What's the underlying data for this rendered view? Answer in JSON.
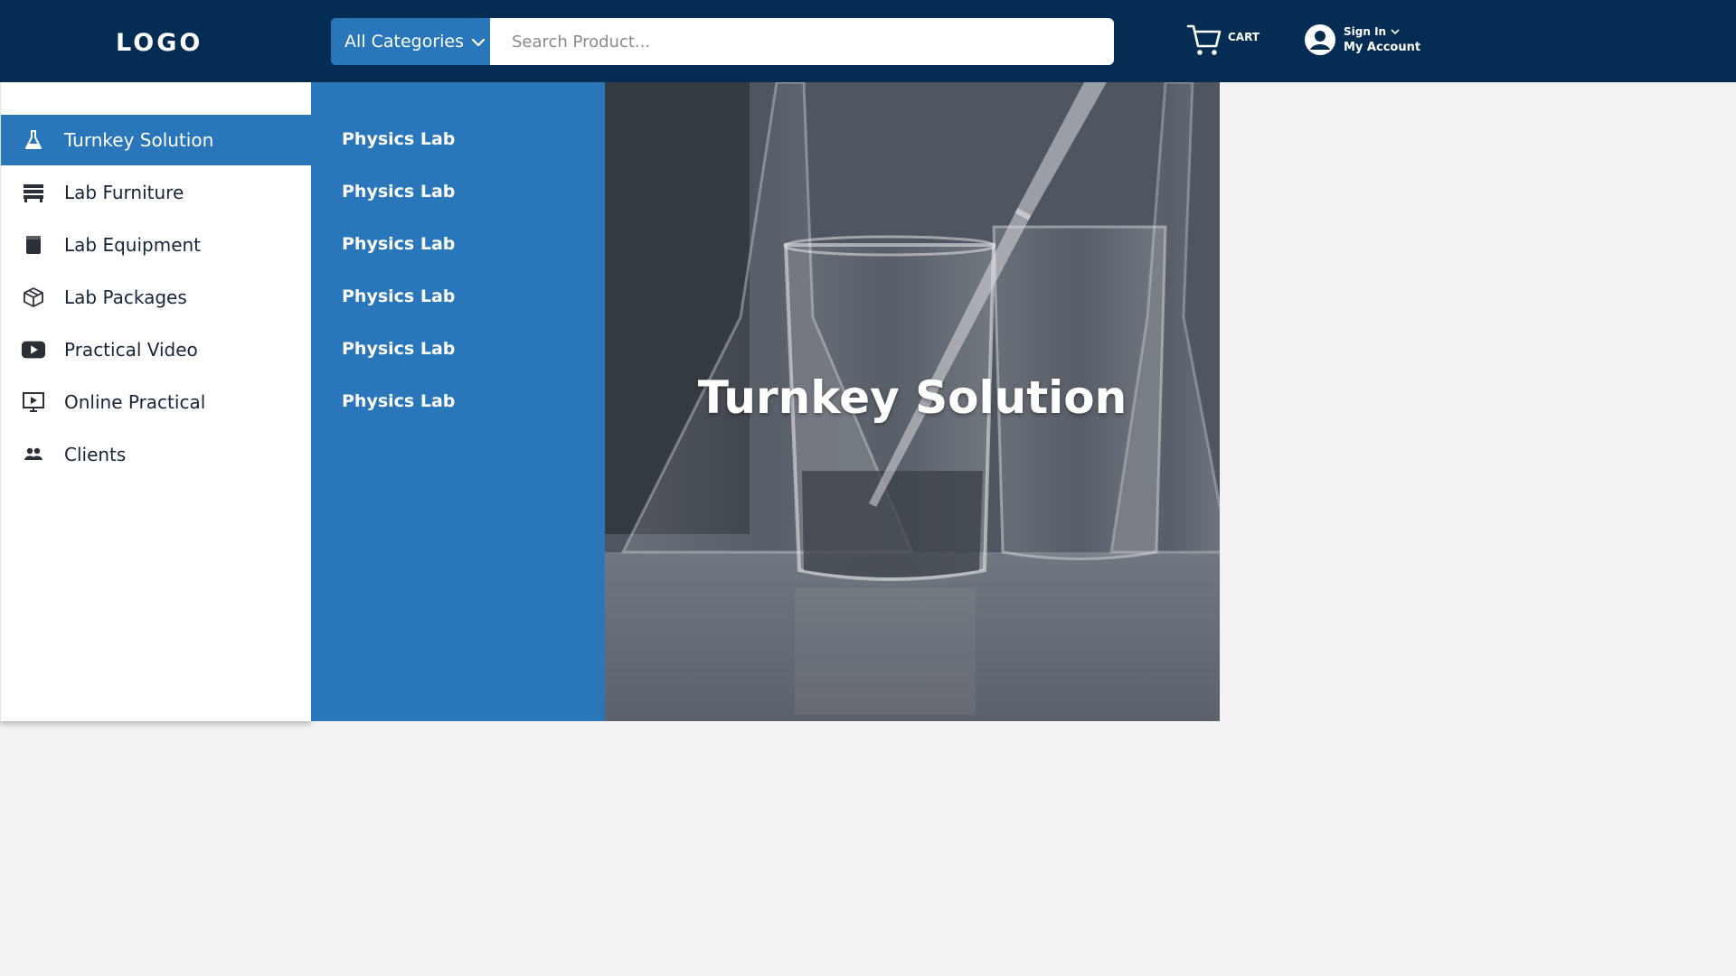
{
  "header": {
    "logo": "LOGO",
    "category_button": "All Categories",
    "search_placeholder": "Search Product...",
    "cart_label": "CART",
    "sign_in": "Sign In",
    "my_account": "My Account"
  },
  "sidebar": {
    "items": [
      {
        "label": "Turnkey Solution",
        "icon": "flask-icon",
        "active": true
      },
      {
        "label": "Lab Furniture",
        "icon": "furniture-icon",
        "active": false
      },
      {
        "label": "Lab Equipment",
        "icon": "beaker-icon",
        "active": false
      },
      {
        "label": "Lab Packages",
        "icon": "box-icon",
        "active": false
      },
      {
        "label": "Practical Video",
        "icon": "play-icon",
        "active": false
      },
      {
        "label": "Online Practical",
        "icon": "monitor-play-icon",
        "active": false
      },
      {
        "label": "Clients",
        "icon": "users-icon",
        "active": false
      }
    ]
  },
  "submenu": {
    "items": [
      "Physics Lab",
      "Physics Lab",
      "Physics Lab",
      "Physics Lab",
      "Physics Lab",
      "Physics Lab"
    ]
  },
  "hero": {
    "title": "Turnkey Solution"
  },
  "colors": {
    "header_bg": "#052c52",
    "accent_blue": "#2a76bb",
    "page_bg": "#f2f2f2",
    "sidebar_text": "#16253a"
  }
}
